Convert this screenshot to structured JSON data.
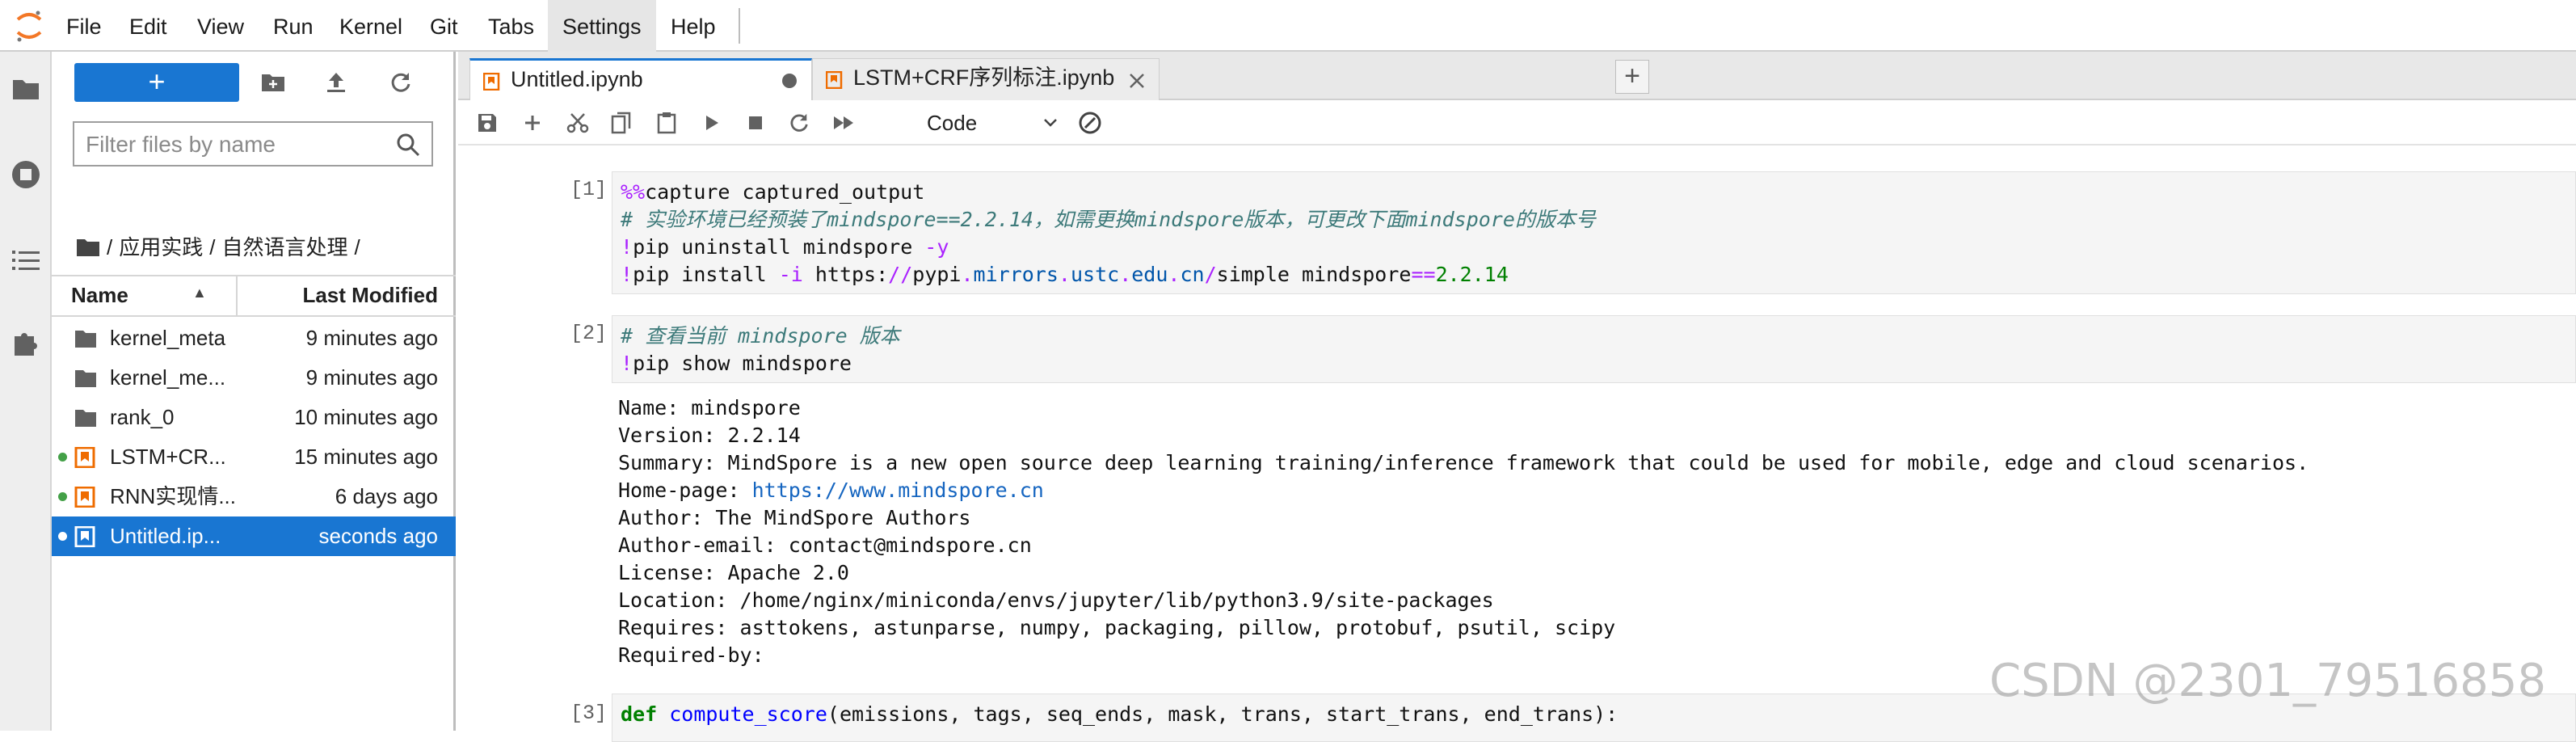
{
  "menubar": {
    "items": [
      "File",
      "Edit",
      "View",
      "Run",
      "Kernel",
      "Git",
      "Tabs",
      "Settings",
      "Help"
    ],
    "active": "Settings"
  },
  "filebrowser": {
    "new_label": "+",
    "filter_placeholder": "Filter files by name",
    "breadcrumb": [
      "/",
      "应用实践",
      "/",
      "自然语言处理",
      "/"
    ],
    "col_name": "Name",
    "col_modified": "Last Modified",
    "files": [
      {
        "name": "kernel_meta",
        "modified": "9 minutes ago",
        "type": "folder",
        "running": false,
        "selected": false
      },
      {
        "name": "kernel_me...",
        "modified": "9 minutes ago",
        "type": "folder",
        "running": false,
        "selected": false
      },
      {
        "name": "rank_0",
        "modified": "10 minutes ago",
        "type": "folder",
        "running": false,
        "selected": false
      },
      {
        "name": "LSTM+CR...",
        "modified": "15 minutes ago",
        "type": "notebook",
        "running": true,
        "selected": false
      },
      {
        "name": "RNN实现情...",
        "modified": "6 days ago",
        "type": "notebook",
        "running": true,
        "selected": false
      },
      {
        "name": "Untitled.ip...",
        "modified": "seconds ago",
        "type": "notebook",
        "running": true,
        "selected": true
      }
    ]
  },
  "tabs": [
    {
      "label": "Untitled.ipynb",
      "active": true,
      "unsaved": true
    },
    {
      "label": "LSTM+CRF序列标注.ipynb",
      "active": false,
      "unsaved": false
    }
  ],
  "toolbar": {
    "cell_type": "Code"
  },
  "cells": {
    "c1": {
      "prompt": "[1]:",
      "l1_magic": "%%",
      "l1_rest": "capture captured_output",
      "l2": "# 实验环境已经预装了mindspore==2.2.14，如需更换mindspore版本，可更改下面mindspore的版本号",
      "l3_bang": "!",
      "l3_rest": "pip uninstall mindspore ",
      "l3_flag": "-y",
      "l4_bang": "!",
      "l4_a": "pip install ",
      "l4_flag": "-i",
      "l4_b": " https:",
      "l4_c": "//",
      "l4_d": "pypi",
      "l4_e": ".",
      "l4_f": "mirrors",
      "l4_g": ".",
      "l4_h": "ustc",
      "l4_i": ".",
      "l4_j": "edu",
      "l4_k": ".",
      "l4_l": "cn",
      "l4_m": "/",
      "l4_n": "simple mindspore",
      "l4_o": "==",
      "l4_p": "2.2.14"
    },
    "c2": {
      "prompt": "[2]:",
      "l1": "# 查看当前 mindspore 版本",
      "l2_bang": "!",
      "l2_rest": "pip show mindspore",
      "output": [
        "Name: mindspore",
        "Version: 2.2.14",
        "Summary: MindSpore is a new open source deep learning training/inference framework that could be used for mobile, edge and cloud scenarios.",
        "Home-page: ",
        "Author: The MindSpore Authors",
        "Author-email: contact@mindspore.cn",
        "License: Apache 2.0",
        "Location: /home/nginx/miniconda/envs/jupyter/lib/python3.9/site-packages",
        "Requires: asttokens, astunparse, numpy, packaging, pillow, protobuf, psutil, scipy",
        "Required-by:"
      ],
      "homepage_link": "https://www.mindspore.cn"
    },
    "c3": {
      "prompt": "[3]:",
      "kw": "def",
      "fn": "compute_score",
      "rest": "(emissions, tags, seq_ends, mask, trans, start_trans, end_trans):"
    }
  },
  "watermark": "CSDN @2301_79516858",
  "colors": {
    "accent": "#1976d2",
    "running_dot": "#43a047",
    "notebook_icon": "#ef6c00"
  }
}
